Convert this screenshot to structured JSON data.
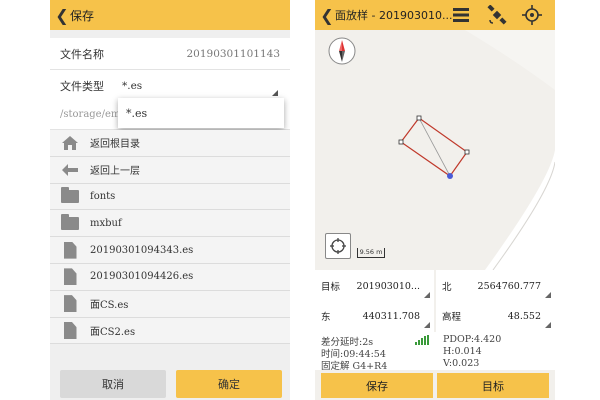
{
  "left": {
    "header": {
      "title": "保存"
    },
    "file_name": {
      "label": "文件名称",
      "value": "20190301101143"
    },
    "file_type": {
      "label": "文件类型",
      "value": "*.es"
    },
    "path": {
      "value": "/storage/emu"
    },
    "dropdown": {
      "option": "*.es"
    },
    "items": [
      {
        "label": "返回根目录",
        "icon": "home-icon"
      },
      {
        "label": "返回上一层",
        "icon": "back-arrow-icon"
      },
      {
        "label": "fonts",
        "icon": "folder-icon"
      },
      {
        "label": "mxbuf",
        "icon": "folder-icon"
      },
      {
        "label": "20190301094343.es",
        "icon": "file-icon"
      },
      {
        "label": "20190301094426.es",
        "icon": "file-icon"
      },
      {
        "label": "面CS.es",
        "icon": "file-icon"
      },
      {
        "label": "面CS2.es",
        "icon": "file-icon"
      }
    ],
    "buttons": {
      "cancel": "取消",
      "confirm": "确定"
    }
  },
  "right": {
    "header": {
      "title": "面放样 - 201903010..."
    },
    "scale": "9.56 m",
    "target": {
      "label": "目标",
      "value": "201903010..."
    },
    "north": {
      "label": "北",
      "value": "2564760.777"
    },
    "east": {
      "label": "东",
      "value": "440311.708"
    },
    "elevation": {
      "label": "高程",
      "value": "48.552"
    },
    "status": {
      "diff_delay": "差分延时:2s",
      "pdop": "PDOP:4.420",
      "time": "时间:09:44:54",
      "h": "H:0.014",
      "fix": "固定解  G4+R4",
      "v": "V:0.023"
    },
    "buttons": {
      "save": "保存",
      "target": "目标"
    }
  },
  "colors": {
    "accent": "#f6c24a",
    "background": "#efefef"
  }
}
